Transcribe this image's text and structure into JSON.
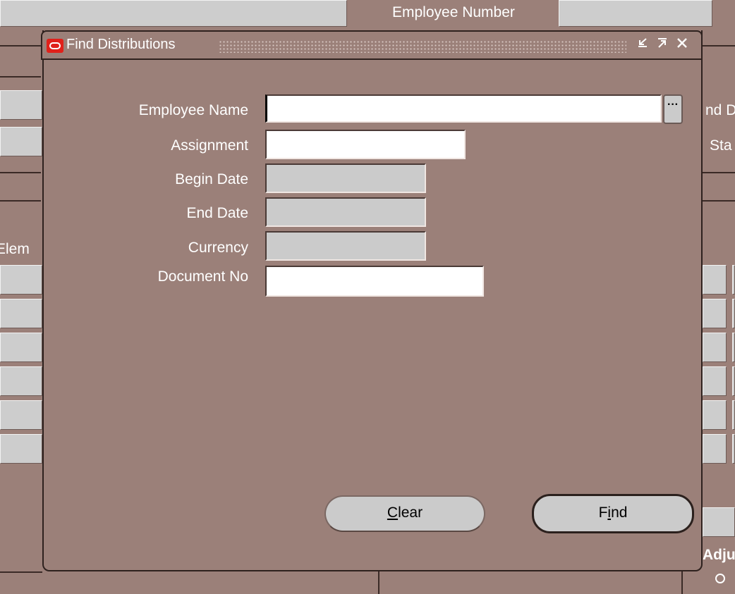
{
  "background": {
    "employee_number_label": "Employee Number",
    "end_date_label_partial": "nd D",
    "status_label_partial": "Sta",
    "element_label_partial": "Elem",
    "adjust_label_partial": "Adju"
  },
  "dialog": {
    "title": "Find Distributions",
    "buttons": {
      "minimize": "⌄",
      "maximize": "⤒",
      "close": "✕"
    },
    "fields": {
      "employee_name": {
        "label": "Employee Name",
        "value": ""
      },
      "assignment": {
        "label": "Assignment",
        "value": ""
      },
      "begin_date": {
        "label": "Begin Date",
        "value": ""
      },
      "end_date": {
        "label": "End Date",
        "value": ""
      },
      "currency": {
        "label": "Currency",
        "value": ""
      },
      "document_no": {
        "label": "Document No",
        "value": ""
      }
    },
    "lov_button_label": "···",
    "clear_button": {
      "mnemonic": "C",
      "rest": "lear"
    },
    "find_button": {
      "pre": "F",
      "mnemonic": "i",
      "rest": "nd"
    }
  },
  "colors": {
    "background": "#9b8079",
    "field_editable": "#ffffff",
    "field_readonly": "#cbcbcb",
    "oracle_red": "#e0201a"
  }
}
